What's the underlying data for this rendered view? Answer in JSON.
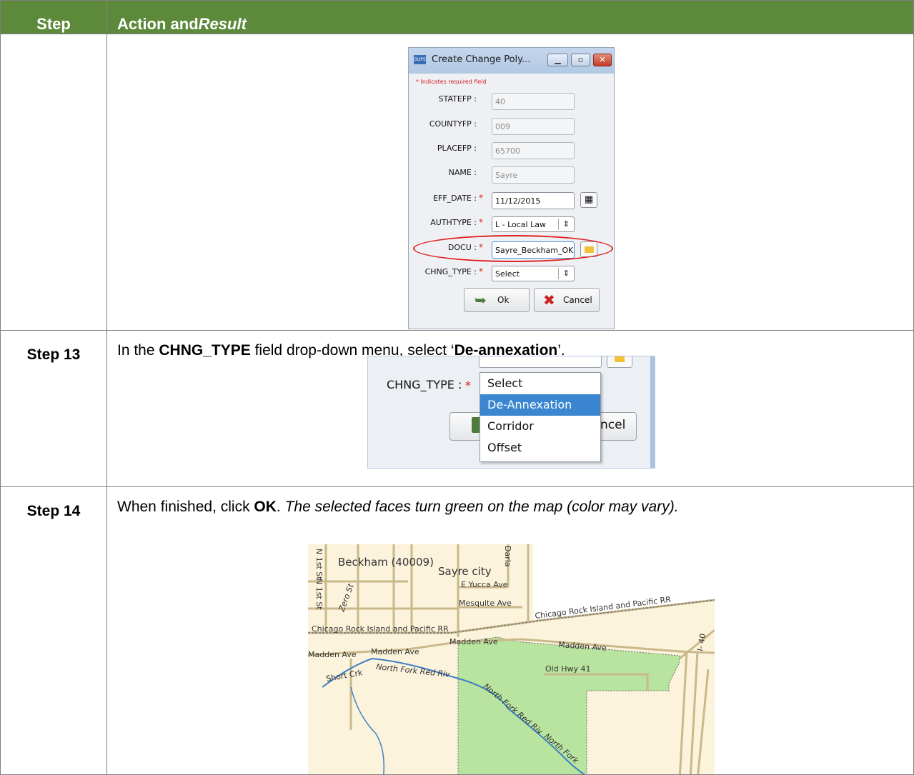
{
  "table": {
    "header": {
      "step": "Step",
      "action_prefix": "Action and ",
      "action_italic": "Result"
    },
    "rows": [
      {
        "step": "",
        "dialog": {
          "title": "Create Change Poly...",
          "app_icon": "GUPS",
          "required_note": "* Indicates required field",
          "fields": [
            {
              "label": "STATEFP :",
              "value": "40",
              "required": false
            },
            {
              "label": "COUNTYFP :",
              "value": "009",
              "required": false
            },
            {
              "label": "PLACEFP :",
              "value": "65700",
              "required": false
            },
            {
              "label": "NAME :",
              "value": "Sayre",
              "required": false
            },
            {
              "label": "EFF_DATE :",
              "value": "11/12/2015",
              "required": true
            },
            {
              "label": "AUTHTYPE :",
              "value": "L - Local Law",
              "required": true
            },
            {
              "label": "DOCU :",
              "value": "Sayre_Beckham_OK",
              "required": true
            },
            {
              "label": "CHNG_TYPE :",
              "value": "Select",
              "required": true
            }
          ],
          "star": "*",
          "ok_label": "Ok",
          "cancel_label": "Cancel",
          "icons": {
            "calendar": "calendar-icon",
            "folder": "folder-icon",
            "ok": "ok-arrow-icon",
            "cancel": "cancel-x-icon"
          }
        }
      },
      {
        "step": "Step 13",
        "instruction": {
          "t1": "In the ",
          "b1": "CHNG_TYPE",
          "t2": " field drop-down menu, select ‘",
          "b2": "De-annexation",
          "t3": "’."
        },
        "dropdown": {
          "label": "CHNG_TYPE :",
          "star": "*",
          "options": [
            "Select",
            "De-Annexation",
            "Corridor",
            "Offset"
          ],
          "highlighted": "De-Annexation",
          "partial_button_text": "ncel"
        }
      },
      {
        "step": "Step 14",
        "instruction": {
          "t1": "When finished, click ",
          "b1": "OK",
          "t2": ". ",
          "i1": "The selected faces turn green on the map (color may vary)."
        },
        "map": {
          "labels": {
            "county": "Beckham (40009)",
            "city": "Sayre city",
            "yucca": "E Yucca Ave",
            "mesquite": "Mesquite Ave",
            "rr1": "Chicago Rock Island and Pacific RR",
            "rr2": "Chicago Rock Island and Pacific RR",
            "madden1": "Madden Ave",
            "madden2": "Madden Ave",
            "madden3": "Madden Ave",
            "madden4": "Madden Ave",
            "hwy": "Old Hwy 41",
            "short": "Short Crk",
            "river1": "North Fork Red Riv",
            "river2": "North Fork Red Riv",
            "river3": "North Fork",
            "zero": "Zero St",
            "n1st": "N 1st St",
            "n1st2": "N 1st St",
            "darla": "Darla",
            "i40": "I- 40"
          },
          "colors": {
            "selected_face": "#b9e4a0",
            "background": "#fbf3dc",
            "river": "#3f7fc3"
          }
        }
      }
    ]
  }
}
